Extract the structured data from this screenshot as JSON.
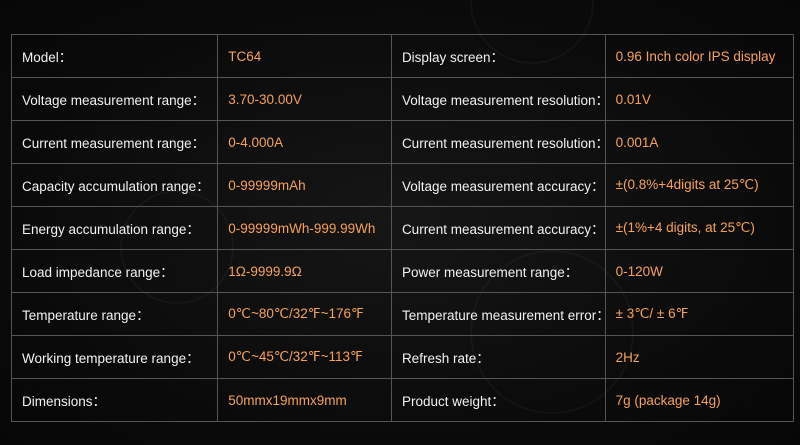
{
  "rows": [
    {
      "label1": "Model：",
      "value1": "TC64",
      "label2": "Display screen：",
      "value2": "0.96 Inch color IPS display"
    },
    {
      "label1": "Voltage measurement range：",
      "value1": "3.70-30.00V",
      "label2": "Voltage measurement resolution：",
      "value2": "0.01V"
    },
    {
      "label1": "Current measurement range：",
      "value1": "0-4.000A",
      "label2": "Current measurement resolution：",
      "value2": "0.001A"
    },
    {
      "label1": "Capacity accumulation range：",
      "value1": "0-99999mAh",
      "label2": "Voltage measurement accuracy：",
      "value2": "±(0.8%+4digits at 25℃)"
    },
    {
      "label1": "Energy accumulation range：",
      "value1": "0-99999mWh-999.99Wh",
      "label2": "Current measurement accuracy：",
      "value2": "±(1%+4 digits, at 25℃)"
    },
    {
      "label1": "Load impedance range：",
      "value1": "1Ω-9999.9Ω",
      "label2": "Power measurement range：",
      "value2": "0-120W"
    },
    {
      "label1": "Temperature range：",
      "value1": "0℃~80℃/32℉~176℉",
      "label2": "Temperature measurement error：",
      "value2": "± 3℃/ ± 6℉"
    },
    {
      "label1": "Working temperature range：",
      "value1": "0℃~45℃/32℉~113℉",
      "label2": "Refresh rate：",
      "value2": "2Hz"
    },
    {
      "label1": "Dimensions：",
      "value1": "50mmx19mmx9mm",
      "label2": "Product weight：",
      "value2": "7g (package 14g)"
    }
  ],
  "colors": {
    "label_text": "#f2f2f2",
    "value_text": "#f7a15a",
    "grid_lines": "#555555",
    "background": "#0b0b0b"
  }
}
